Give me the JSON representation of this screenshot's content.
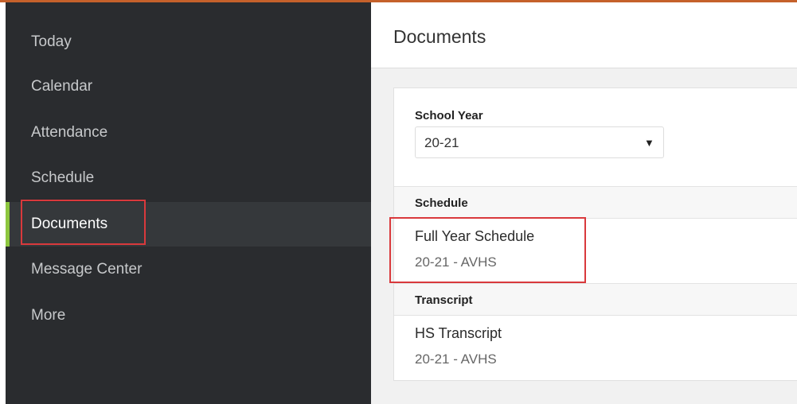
{
  "nav": {
    "items": [
      {
        "label": "Today",
        "active": false
      },
      {
        "label": "Calendar",
        "active": false
      },
      {
        "label": "Attendance",
        "active": false
      },
      {
        "label": "Schedule",
        "active": false
      },
      {
        "label": "Documents",
        "active": true
      },
      {
        "label": "Message Center",
        "active": false
      },
      {
        "label": "More",
        "active": false
      }
    ]
  },
  "main": {
    "title": "Documents",
    "school_year": {
      "label": "School Year",
      "value": "20-21"
    },
    "sections": [
      {
        "heading": "Schedule",
        "documents": [
          {
            "title": "Full Year Schedule",
            "subtitle": "20-21 - AVHS"
          }
        ]
      },
      {
        "heading": "Transcript",
        "documents": [
          {
            "title": "HS Transcript",
            "subtitle": "20-21 - AVHS"
          }
        ]
      }
    ]
  },
  "colors": {
    "sidebar_bg": "#2a2c2f",
    "active_accent": "#8dc63f",
    "highlight_box": "#d9393c",
    "top_rule": "#c5612b"
  }
}
